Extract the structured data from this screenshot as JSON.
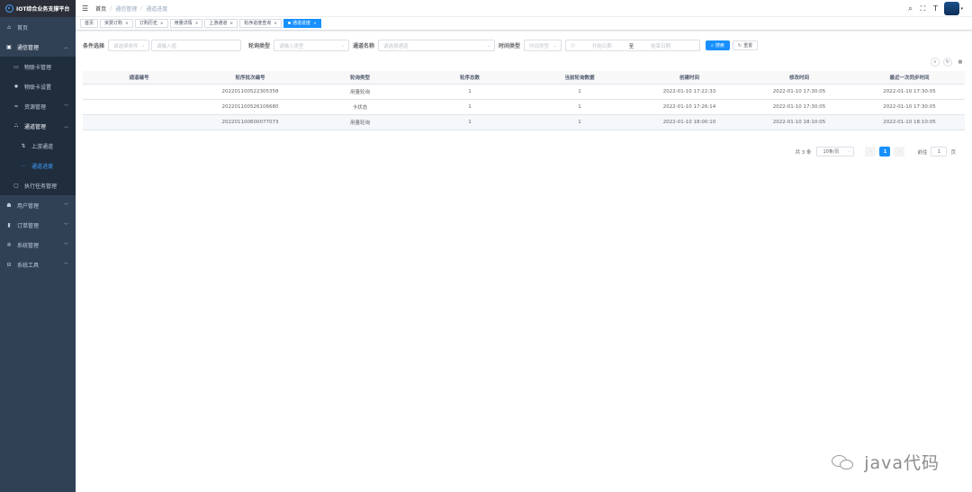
{
  "app": {
    "title": "IOT综合业务支撑平台"
  },
  "sidebar": {
    "items": [
      {
        "label": "首页",
        "icon": "home-icon"
      },
      {
        "label": "通信管理",
        "icon": "sim-icon"
      },
      {
        "label": "物联卡管理",
        "icon": "card-icon"
      },
      {
        "label": "物联卡设置",
        "icon": "gear-icon"
      },
      {
        "label": "资源管理",
        "icon": "resource-icon"
      },
      {
        "label": "通道管理",
        "icon": "tree-icon"
      },
      {
        "label": "上游通道",
        "icon": "upstream-icon"
      },
      {
        "label": "通道进度",
        "icon": "progress-icon"
      },
      {
        "label": "执行任务管理",
        "icon": "monitor-icon"
      },
      {
        "label": "用户管理",
        "icon": "user-icon"
      },
      {
        "label": "订单管理",
        "icon": "chart-icon"
      },
      {
        "label": "系统管理",
        "icon": "settings-icon"
      },
      {
        "label": "系统工具",
        "icon": "toolbox-icon"
      }
    ]
  },
  "breadcrumb": {
    "home": "首页",
    "parent": "通信管理",
    "current": "通道进度"
  },
  "tags": [
    {
      "label": "首页"
    },
    {
      "label": "资费订购"
    },
    {
      "label": "订购历史"
    },
    {
      "label": "用量详情"
    },
    {
      "label": "上游通道"
    },
    {
      "label": "轮序进度查询"
    },
    {
      "label": "通道进度"
    }
  ],
  "filters": {
    "condition_label": "条件选择",
    "condition_placeholder": "请选择条件",
    "keyword_placeholder": "请输入值",
    "rotation_label": "轮询类型",
    "rotation_placeholder": "请输入类型",
    "channel_label": "通道名称",
    "channel_placeholder": "请选择通道",
    "time_label": "时间类型",
    "time_placeholder": "时间类型",
    "start_placeholder": "开始日期",
    "range_sep": "至",
    "end_placeholder": "结束日期",
    "search_label": "搜索",
    "reset_label": "重置"
  },
  "table": {
    "headers": [
      "通道编号",
      "轮序批次编号",
      "轮询类型",
      "轮序总数",
      "当前轮询数据",
      "创建时间",
      "修改时间",
      "最近一次同步时间"
    ],
    "rows": [
      [
        "",
        "202201100522305358",
        "用量轮询",
        "1",
        "1",
        "2022-01-10 17:22:33",
        "2022-01-10 17:30:05",
        "2022-01-10 17:30:05"
      ],
      [
        "",
        "202201100526106680",
        "卡状态",
        "1",
        "1",
        "2022-01-10 17:26:14",
        "2022-01-10 17:30:05",
        "2022-01-10 17:30:05"
      ],
      [
        "",
        "202201100600077073",
        "用量轮询",
        "1",
        "1",
        "2022-01-10 18:00:10",
        "2022-01-10 18:10:05",
        "2022-01-10 18:10:05"
      ]
    ]
  },
  "pagination": {
    "total_text": "共 3 条",
    "page_size": "10条/页",
    "current_page": "1",
    "goto_label": "前往",
    "goto_value": "1",
    "page_suffix": "页"
  },
  "watermark": {
    "text": "java代码"
  },
  "colors": {
    "sidebar_bg": "#304156",
    "primary": "#1890ff"
  }
}
